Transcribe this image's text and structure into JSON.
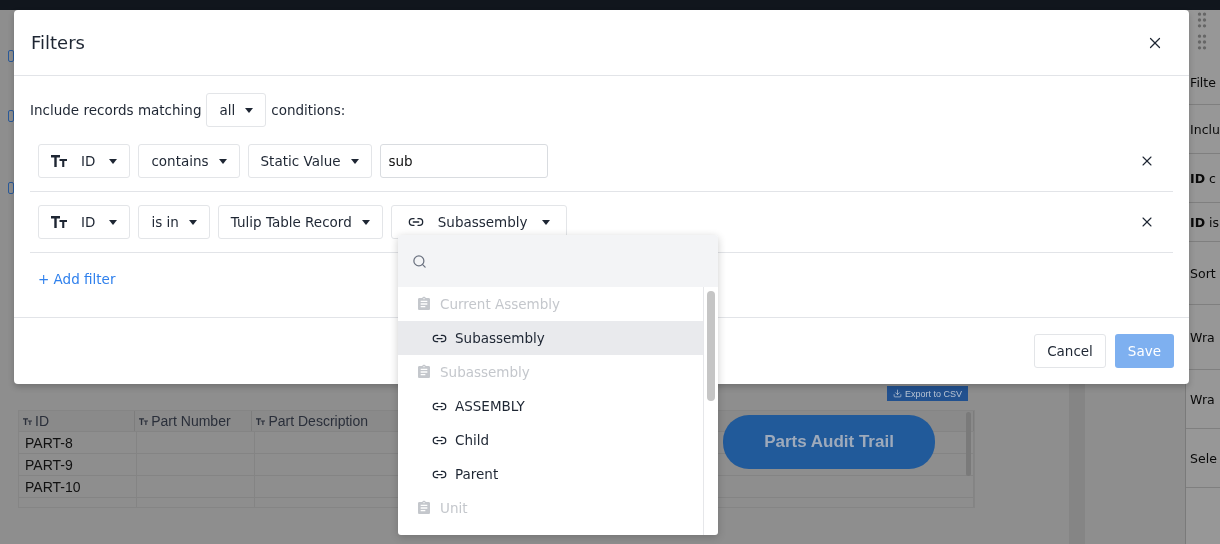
{
  "canvas": {
    "export_button": "Export to CSV",
    "audit_button": "Parts Audit Trail",
    "table": {
      "columns": [
        "ID",
        "Part Number",
        "Part Description"
      ],
      "rows": [
        {
          "id": "PART-8"
        },
        {
          "id": "PART-9"
        },
        {
          "id": "PART-10"
        }
      ]
    }
  },
  "side_panel": {
    "labels": [
      "Filte",
      "Inclu",
      "**ID** c",
      "**ID** is",
      "Sort",
      "Wra",
      "Wra",
      "Sele"
    ]
  },
  "modal": {
    "title": "Filters",
    "match_prefix": "Include records matching",
    "match_value": "all",
    "match_suffix": "conditions:",
    "filters": [
      {
        "field": "ID",
        "operator": "contains",
        "source": "Static Value",
        "value": "sub"
      },
      {
        "field": "ID",
        "operator": "is in",
        "source": "Tulip Table Record",
        "link_value": "Subassembly"
      }
    ],
    "add_filter": "+ Add filter",
    "cancel": "Cancel",
    "save": "Save",
    "save_disabled": true,
    "dropdown": {
      "items": [
        {
          "kind": "group",
          "label": "Current Assembly"
        },
        {
          "kind": "option",
          "label": "Subassembly",
          "selected": true
        },
        {
          "kind": "group",
          "label": "Subassembly"
        },
        {
          "kind": "option",
          "label": "ASSEMBLY",
          "selected": false
        },
        {
          "kind": "option",
          "label": "Child",
          "selected": false
        },
        {
          "kind": "option",
          "label": "Parent",
          "selected": false
        },
        {
          "kind": "group",
          "label": "Unit"
        }
      ]
    }
  }
}
